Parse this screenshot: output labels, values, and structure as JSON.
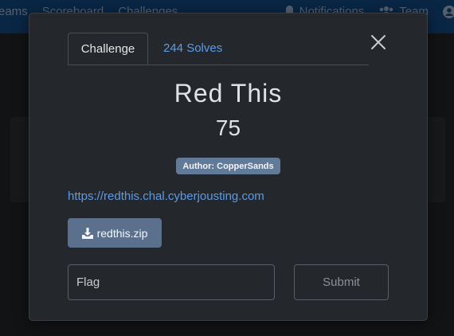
{
  "navbar": {
    "items_left": [
      "eams",
      "Scoreboard",
      "Challenges"
    ],
    "notifications_label": "Notifications",
    "team_label": "Team"
  },
  "modal": {
    "tabs": {
      "challenge": "Challenge",
      "solves": "244 Solves"
    },
    "title": "Red This",
    "value": "75",
    "author_badge": "Author: CopperSands",
    "link": "https://redthis.chal.cyberjousting.com",
    "download": {
      "label": "redthis.zip",
      "icon": "download-icon"
    },
    "flag": {
      "placeholder": "Flag",
      "value": ""
    },
    "submit_label": "Submit"
  },
  "colors": {
    "navbar": "#11457f",
    "modal_bg": "#24272b",
    "link": "#5b9be8",
    "badge": "#617a97",
    "download_button": "#5b708c"
  }
}
